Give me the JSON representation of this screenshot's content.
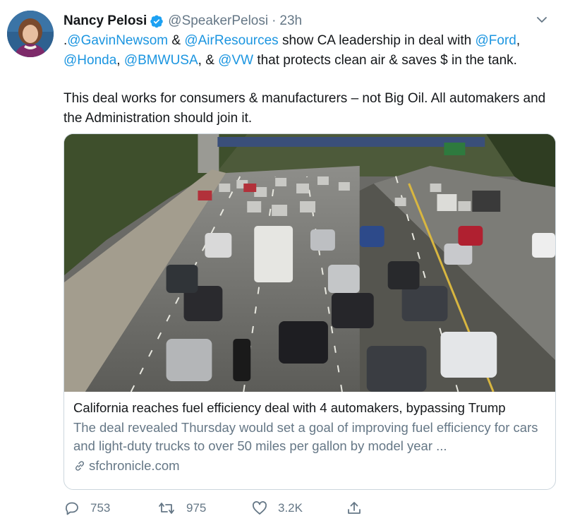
{
  "tweet": {
    "author_name": "Nancy Pelosi",
    "author_handle": "@SpeakerPelosi",
    "separator": "·",
    "timestamp": "23h",
    "text_line1": {
      "prefix": ".",
      "mention1": "@GavinNewsom",
      "amp1": " & ",
      "mention2": "@AirResources",
      "mid": " show CA leadership in deal with ",
      "mention3": "@Ford",
      "comma1": ", ",
      "mention4": "@Honda",
      "comma2": ", ",
      "mention5": "@BMWUSA",
      "comma3": ", & ",
      "mention6": "@VW",
      "tail": " that protects clean air & saves $ in the tank."
    },
    "text_paragraph2": "This deal works for consumers & manufacturers – not Big Oil. All automakers and the Administration should join it."
  },
  "card": {
    "image_name": "freeway-traffic-photo",
    "title": "California reaches fuel efficiency deal with 4 automakers, bypassing Trump",
    "description": "The deal revealed Thursday would set a goal of improving fuel efficiency for cars and light-duty trucks to over 50 miles per gallon by model year ...",
    "domain": "sfchronicle.com"
  },
  "actions": {
    "reply_count": "753",
    "retweet_count": "975",
    "like_count": "3.2K"
  },
  "colors": {
    "link": "#1b95e0",
    "secondary": "#657786",
    "verified": "#1da1f2",
    "border": "#ccd6dd"
  },
  "icons": [
    "verified-badge-icon",
    "chevron-down-icon",
    "link-icon",
    "reply-icon",
    "retweet-icon",
    "like-icon",
    "share-icon"
  ]
}
